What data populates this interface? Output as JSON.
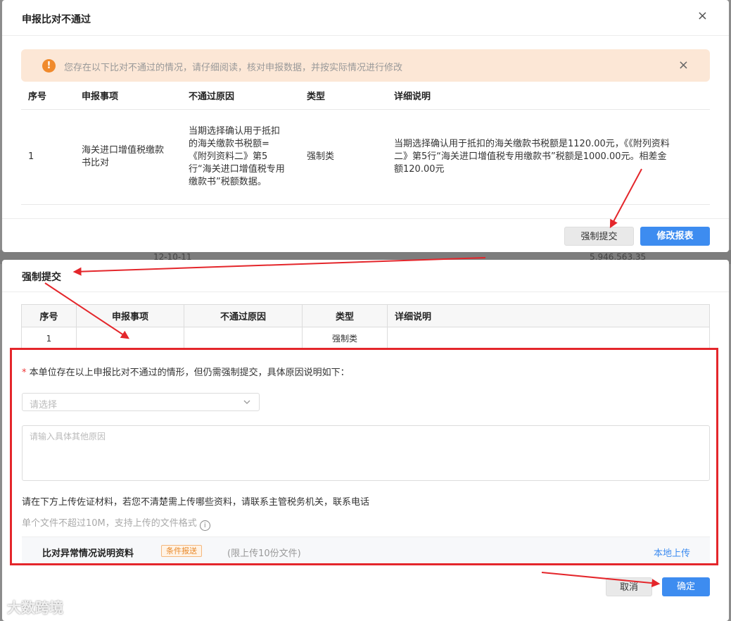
{
  "background": {
    "left_text": "12-10-11",
    "right_text": "5,946,563.35"
  },
  "modal1": {
    "title": "申报比对不通过",
    "alert_text": "您存在以下比对不通过的情况，请仔细阅读，核对申报数据，并按实际情况进行修改",
    "table": {
      "headers": [
        "序号",
        "申报事项",
        "不通过原因",
        "类型",
        "详细说明"
      ],
      "rows": [
        {
          "no": "1",
          "item": "海关进口增值税缴款书比对",
          "reason": "当期选择确认用于抵扣的海关缴款书税额=《附列资料二》第5行“海关进口增值税专用缴款书”税额数据。",
          "type": "强制类",
          "detail": "当期选择确认用于抵扣的海关缴款书税额是1120.00元，《《附列资料二》第5行“海关进口增值税专用缴款书”税额是1000.00元。相差金额120.00元"
        }
      ]
    },
    "force_submit_label": "强制提交",
    "modify_report_label": "修改报表"
  },
  "modal2": {
    "title": "强制提交",
    "table": {
      "headers": [
        "序号",
        "申报事项",
        "不通过原因",
        "类型",
        "详细说明"
      ],
      "rows": [
        {
          "no": "1",
          "item": "",
          "reason": "",
          "type": "强制类",
          "detail": ""
        }
      ]
    },
    "required_label": "本单位存在以上申报比对不通过的情形，但仍需强制提交，具体原因说明如下：",
    "select_placeholder": "请选择",
    "textarea_placeholder": "请输入具体其他原因",
    "upload_instruction": "请在下方上传佐证材料，若您不清楚需上传哪些资料，请联系主管税务机关，联系电话",
    "file_limit_text": "单个文件不超过10M，支持上传的文件格式",
    "upload_row": {
      "label": "比对异常情况说明资料",
      "badge": "条件报送",
      "limit": "(限上传10份文件)",
      "link": "本地上传"
    },
    "cancel_label": "取消",
    "confirm_label": "确定"
  },
  "watermark": "大数跨境",
  "colors": {
    "primary": "#3d8cf0",
    "alert_bg": "#fce7d6",
    "alert_icon": "#f08a2c",
    "annotation_red": "#e4262b",
    "badge_orange": "#e8892b"
  }
}
